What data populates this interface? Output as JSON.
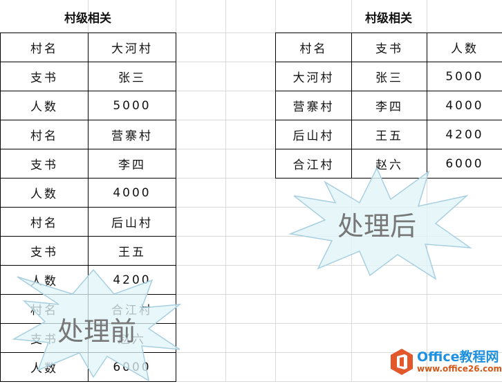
{
  "left_table": {
    "title": "村级相关",
    "rows": [
      [
        "村名",
        "大河村"
      ],
      [
        "支书",
        "张三"
      ],
      [
        "人数",
        "5000"
      ],
      [
        "村名",
        "营寨村"
      ],
      [
        "支书",
        "李四"
      ],
      [
        "人数",
        "4000"
      ],
      [
        "村名",
        "后山村"
      ],
      [
        "支书",
        "王五"
      ],
      [
        "人数",
        "4200"
      ],
      [
        "村名",
        "合江村"
      ],
      [
        "支书",
        "赵六"
      ],
      [
        "人数",
        "6000"
      ]
    ]
  },
  "right_table": {
    "title": "村级相关",
    "headers": [
      "村名",
      "支书",
      "人数"
    ],
    "rows": [
      [
        "大河村",
        "张三",
        "5000"
      ],
      [
        "营寨村",
        "李四",
        "4000"
      ],
      [
        "后山村",
        "王五",
        "4200"
      ],
      [
        "合江村",
        "赵六",
        "6000"
      ]
    ]
  },
  "annotations": {
    "before": "处理前",
    "after": "处理后"
  },
  "logo": {
    "name": "Office教程网",
    "url": "www.office26.com",
    "color_orange": "#e2582a",
    "color_blue": "#1e90e0"
  }
}
